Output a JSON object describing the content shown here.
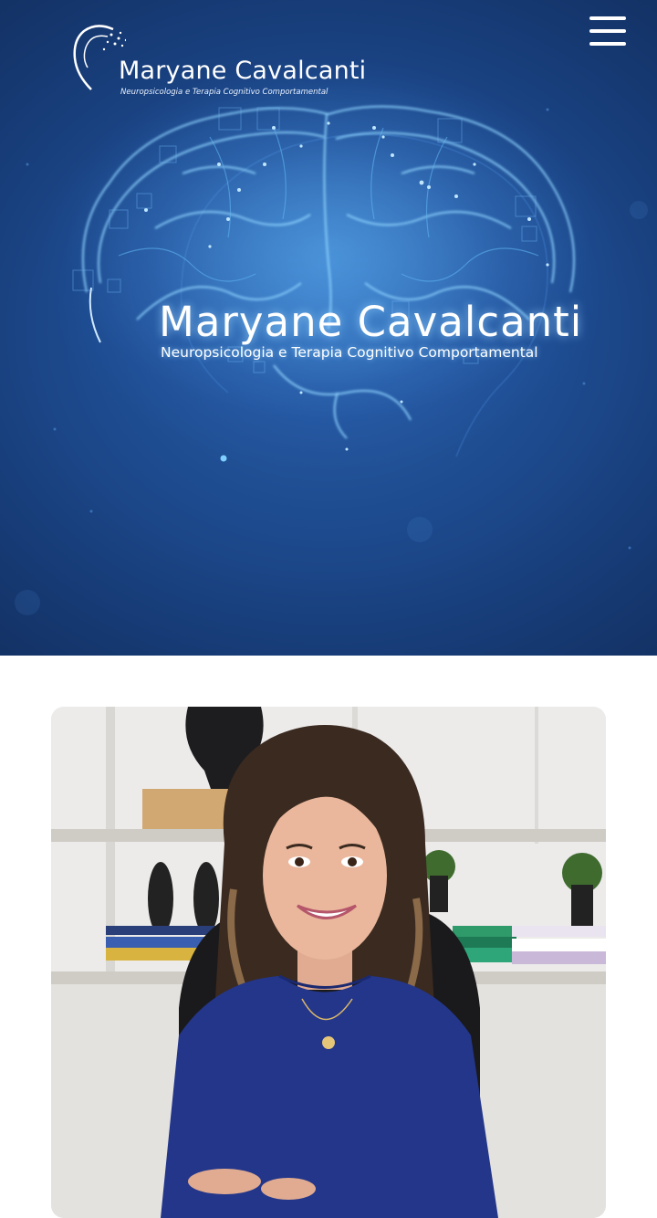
{
  "header": {
    "logo": {
      "name": "Maryane Cavalcanti",
      "tagline": "Neuropsicologia e Terapia Cognitivo Comportamental"
    },
    "menu_icon": "hamburger-menu-icon"
  },
  "hero": {
    "title": "Maryane Cavalcanti",
    "subtitle": "Neuropsicologia e Terapia Cognitivo Comportamental",
    "image": "glowing-brain-illustration"
  },
  "profile": {
    "image": "portrait-photo"
  },
  "colors": {
    "hero_background": "#1d4a8e",
    "glow": "#6fc3ff",
    "page_background": "#ffffff"
  }
}
